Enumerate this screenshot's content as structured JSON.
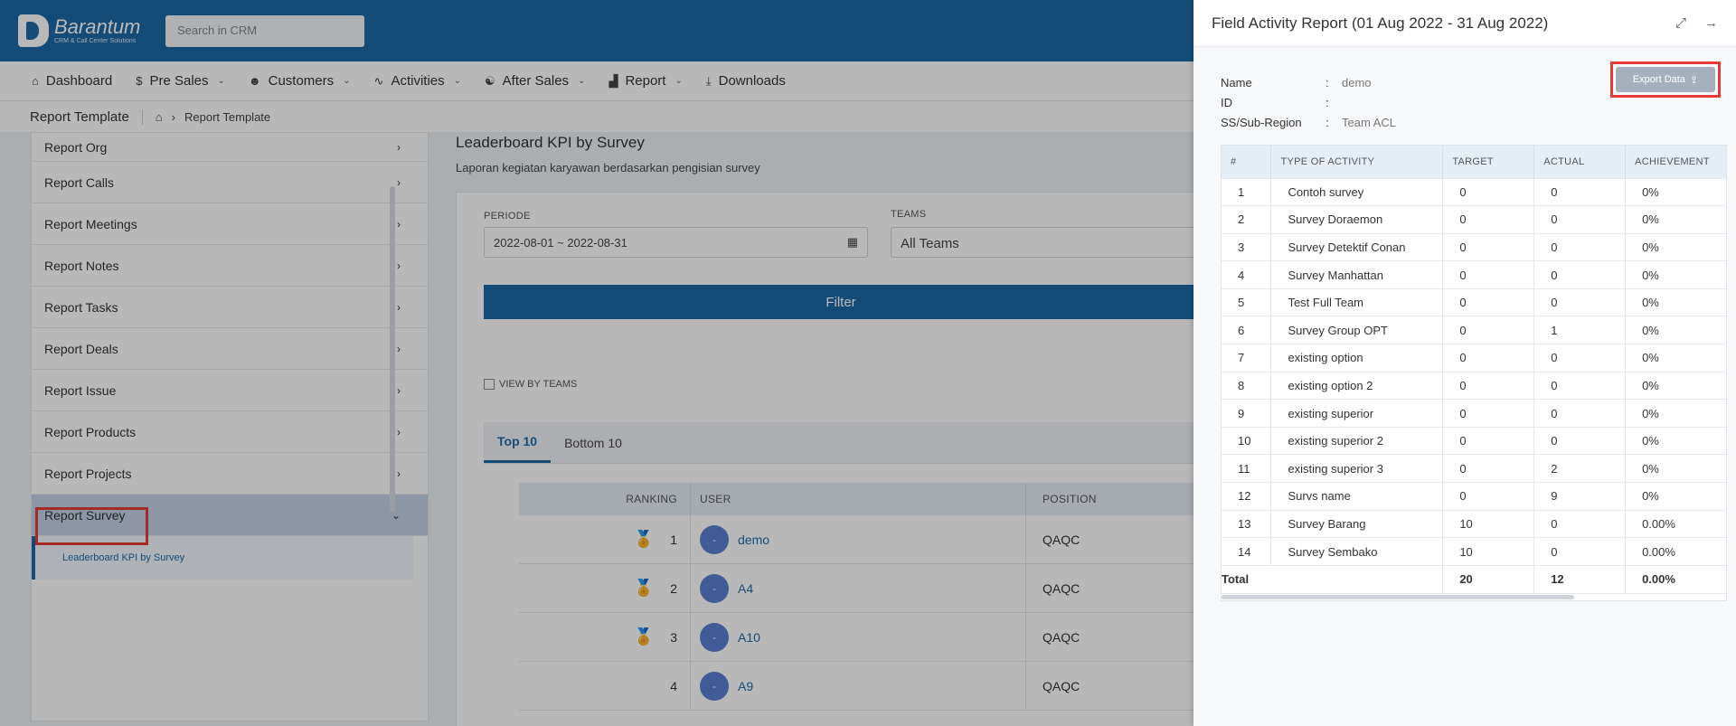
{
  "brand": {
    "name": "Barantum",
    "tagline": "CRM & Call Center Solutions"
  },
  "search": {
    "placeholder": "Search in CRM"
  },
  "nav": [
    {
      "label": "Dashboard",
      "icon": "home-icon"
    },
    {
      "label": "Pre Sales",
      "icon": "dollar-icon"
    },
    {
      "label": "Customers",
      "icon": "users-icon"
    },
    {
      "label": "Activities",
      "icon": "activity-icon"
    },
    {
      "label": "After Sales",
      "icon": "handshake-icon"
    },
    {
      "label": "Report",
      "icon": "chart-icon"
    },
    {
      "label": "Downloads",
      "icon": "download-icon"
    }
  ],
  "breadcrumb": {
    "title": "Report Template",
    "current": "Report Template"
  },
  "sidebar": {
    "items": [
      "Report Org",
      "Report Calls",
      "Report Meetings",
      "Report Notes",
      "Report Tasks",
      "Report Deals",
      "Report Issue",
      "Report Products",
      "Report Projects",
      "Report Survey"
    ],
    "sub": "Leaderboard KPI by Survey"
  },
  "main": {
    "title": "Leaderboard KPI by Survey",
    "desc": "Laporan kegiatan karyawan berdasarkan pengisian survey",
    "periode_label": "PERIODE",
    "periode_value": "2022-08-01 ~ 2022-08-31",
    "teams_label": "TEAMS",
    "teams_value": "All Teams",
    "filter": "Filter",
    "view_by_teams": "VIEW BY TEAMS",
    "tabs": [
      "Top 10",
      "Bottom 10"
    ],
    "cols": [
      "RANKING",
      "USER",
      "POSITION"
    ],
    "rows": [
      {
        "rank": "1",
        "user": "demo",
        "position": "QAQC",
        "avatar": "-"
      },
      {
        "rank": "2",
        "user": "A4",
        "position": "QAQC",
        "avatar": "-"
      },
      {
        "rank": "3",
        "user": "A10",
        "position": "QAQC",
        "avatar": "-"
      },
      {
        "rank": "4",
        "user": "A9",
        "position": "QAQC",
        "avatar": "-"
      }
    ]
  },
  "panel": {
    "title": "Field Activity Report (01 Aug 2022 - 31 Aug 2022)",
    "export": "Export Data",
    "info": [
      {
        "k": "Name",
        "v": "demo"
      },
      {
        "k": "ID",
        "v": ""
      },
      {
        "k": "SS/Sub-Region",
        "v": "Team ACL"
      }
    ],
    "cols": [
      "#",
      "TYPE OF ACTIVITY",
      "TARGET",
      "ACTUAL",
      "ACHIEVEMENT"
    ],
    "rows": [
      [
        "1",
        "Contoh survey",
        "0",
        "0",
        "0%"
      ],
      [
        "2",
        "Survey Doraemon",
        "0",
        "0",
        "0%"
      ],
      [
        "3",
        "Survey Detektif Conan",
        "0",
        "0",
        "0%"
      ],
      [
        "4",
        "Survey Manhattan",
        "0",
        "0",
        "0%"
      ],
      [
        "5",
        "Test Full Team",
        "0",
        "0",
        "0%"
      ],
      [
        "6",
        "Survey Group OPT",
        "0",
        "1",
        "0%"
      ],
      [
        "7",
        "existing option",
        "0",
        "0",
        "0%"
      ],
      [
        "8",
        "existing option 2",
        "0",
        "0",
        "0%"
      ],
      [
        "9",
        "existing superior",
        "0",
        "0",
        "0%"
      ],
      [
        "10",
        "existing superior 2",
        "0",
        "0",
        "0%"
      ],
      [
        "11",
        "existing superior 3",
        "0",
        "2",
        "0%"
      ],
      [
        "12",
        "Survs name",
        "0",
        "9",
        "0%"
      ],
      [
        "13",
        "Survey Barang",
        "10",
        "0",
        "0.00%"
      ],
      [
        "14",
        "Survey Sembako",
        "10",
        "0",
        "0.00%"
      ]
    ],
    "total": {
      "label": "Total",
      "target": "20",
      "actual": "12",
      "achievement": "0.00%"
    }
  }
}
